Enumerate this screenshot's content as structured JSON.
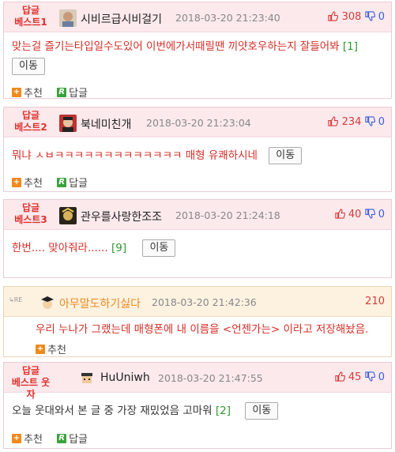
{
  "actions": {
    "recommend": "추천",
    "reply": "답글",
    "move": "이동"
  },
  "comments": [
    {
      "badge_line1": "답글",
      "badge_line2": "베스트1",
      "nickname": "시비르급시비걸기",
      "date": "2018-03-20 21:23:40",
      "up": "308",
      "down": "0",
      "text": "맞는걸 즐기는타입일수도있어 이번에가서때릴땐 끼얏호우하는지 잘들어봐",
      "reply_count": "[1]"
    },
    {
      "badge_line1": "답글",
      "badge_line2": "베스트2",
      "nickname": "북네미친개",
      "date": "2018-03-20 21:23:04",
      "up": "234",
      "down": "0",
      "text": "뭐냐 ㅅㅂㅋㅋㅋㅋㅋㅋㅋㅋㅋㅋㅋㅋㅋ 매형 유쾌하시네"
    },
    {
      "badge_line1": "답글",
      "badge_line2": "베스트3",
      "nickname": "관우를사랑한조조",
      "date": "2018-03-20 21:24:18",
      "up": "40",
      "down": "0",
      "text": "한번.... 맞아줘라......",
      "reply_count": "[9]"
    },
    {
      "re_label": "RE",
      "nickname": "아무말도하기싫다",
      "date": "2018-03-20 21:42:36",
      "up": "210",
      "text": "우리 누나가 그랬는데 매형폰에 내 이름을 <언젠가는> 이라고 저장해놨음."
    },
    {
      "badge_line1": "답글",
      "badge_line2": "베스트 웃자",
      "nickname": "HuUniwh",
      "date": "2018-03-20 21:47:55",
      "up": "45",
      "down": "0",
      "text": "오늘 웃대와서 본 글 중 가장 재밌었음 고마워",
      "reply_count": "[2]"
    }
  ]
}
